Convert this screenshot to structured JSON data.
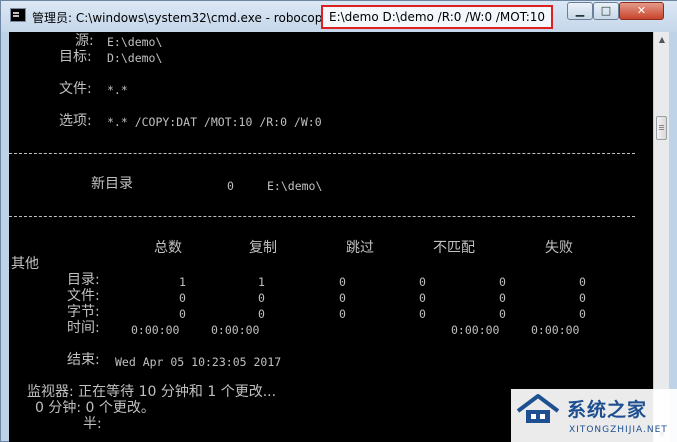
{
  "window": {
    "title": "管理员: C:\\windows\\system32\\cmd.exe - robocopy",
    "title_args": "E:\\demo D:\\demo /R:0 /W:0 /MOT:10",
    "highlight_color": "#e02020",
    "buttons": {
      "minimize_icon": "minimize-icon",
      "maximize_icon": "maximize-icon",
      "close_icon": "close-icon",
      "minimize_glyph": "▁",
      "maximize_glyph": "□",
      "close_glyph": "✕"
    }
  },
  "console": {
    "background": "#000000",
    "foreground": "#c0c0c0",
    "source_label": "源:",
    "source_value": "E:\\demo\\",
    "dest_label": "目标:",
    "dest_value": "D:\\demo\\",
    "files_label": "文件:",
    "files_value": "*.*",
    "options_label": "选项:",
    "options_value": "*.* /COPY:DAT /MOT:10 /R:0 /W:0",
    "new_dir_label": "新目录",
    "new_dir_count": "0",
    "new_dir_path": "E:\\demo\\",
    "stats": {
      "headers": [
        "总数",
        "复制",
        "跳过",
        "不匹配",
        "失败",
        "其他"
      ],
      "rows": [
        {
          "label": "目录:",
          "values": [
            "1",
            "1",
            "0",
            "0",
            "0",
            "0"
          ]
        },
        {
          "label": "文件:",
          "values": [
            "0",
            "0",
            "0",
            "0",
            "0",
            "0"
          ]
        },
        {
          "label": "字节:",
          "values": [
            "0",
            "0",
            "0",
            "0",
            "0",
            "0"
          ]
        },
        {
          "label": "时间:",
          "values": [
            "0:00:00",
            "0:00:00",
            "",
            "",
            "0:00:00",
            "0:00:00"
          ]
        }
      ]
    },
    "end_label": "结束:",
    "end_value": "Wed Apr 05 10:23:05 2017",
    "monitor_line": "监视器: 正在等待 10 分钟和 1 个更改...",
    "minutes_line": "0 分钟: 0 个更改。",
    "half_line": "半:"
  },
  "watermark": {
    "brand": "系统之家",
    "url": "XITONGZHIJIA.NET",
    "logo_icon": "house-logo-icon"
  }
}
